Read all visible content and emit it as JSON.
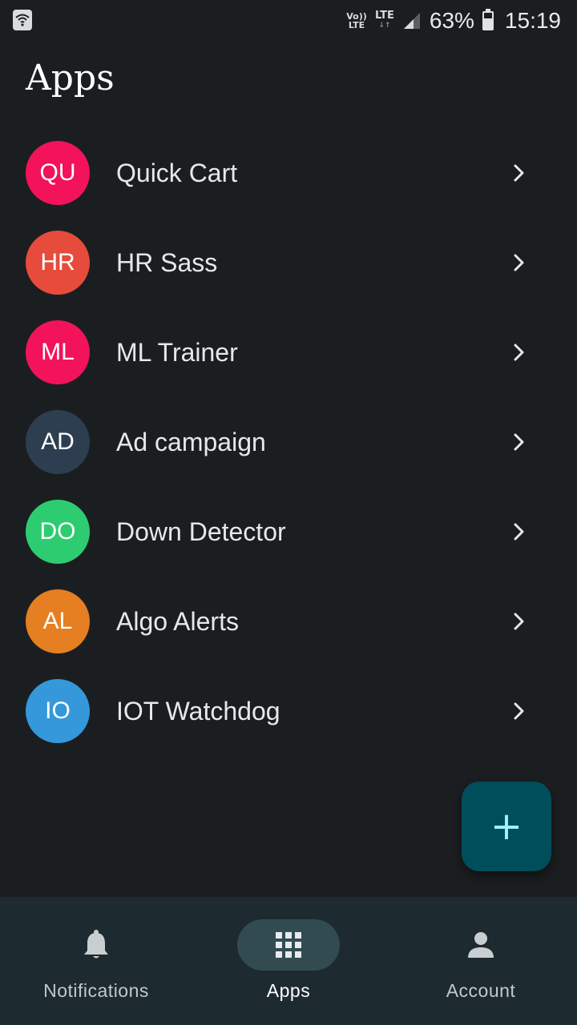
{
  "status_bar": {
    "volte": "Vo)) LTE",
    "network": "LTE",
    "battery_percent": "63%",
    "time": "15:19",
    "icons": [
      "wifi-icon",
      "signal-icon",
      "battery-icon"
    ]
  },
  "header": {
    "title": "Apps"
  },
  "apps": [
    {
      "initials": "QU",
      "name": "Quick Cart",
      "color": "#f2135a"
    },
    {
      "initials": "HR",
      "name": "HR Sass",
      "color": "#e64b3c"
    },
    {
      "initials": "ML",
      "name": "ML Trainer",
      "color": "#f2135a"
    },
    {
      "initials": "AD",
      "name": "Ad campaign",
      "color": "#2d3e50"
    },
    {
      "initials": "DO",
      "name": "Down Detector",
      "color": "#2ecc71"
    },
    {
      "initials": "AL",
      "name": "Algo Alerts",
      "color": "#e67e22"
    },
    {
      "initials": "IO",
      "name": "IOT Watchdog",
      "color": "#3498db"
    }
  ],
  "fab": {
    "label": "+",
    "icon": "plus-icon",
    "color": "#004e59"
  },
  "bottom_nav": {
    "items": [
      {
        "label": "Notifications",
        "icon": "bell-icon",
        "active": false
      },
      {
        "label": "Apps",
        "icon": "grid-icon",
        "active": true
      },
      {
        "label": "Account",
        "icon": "person-icon",
        "active": false
      }
    ]
  }
}
